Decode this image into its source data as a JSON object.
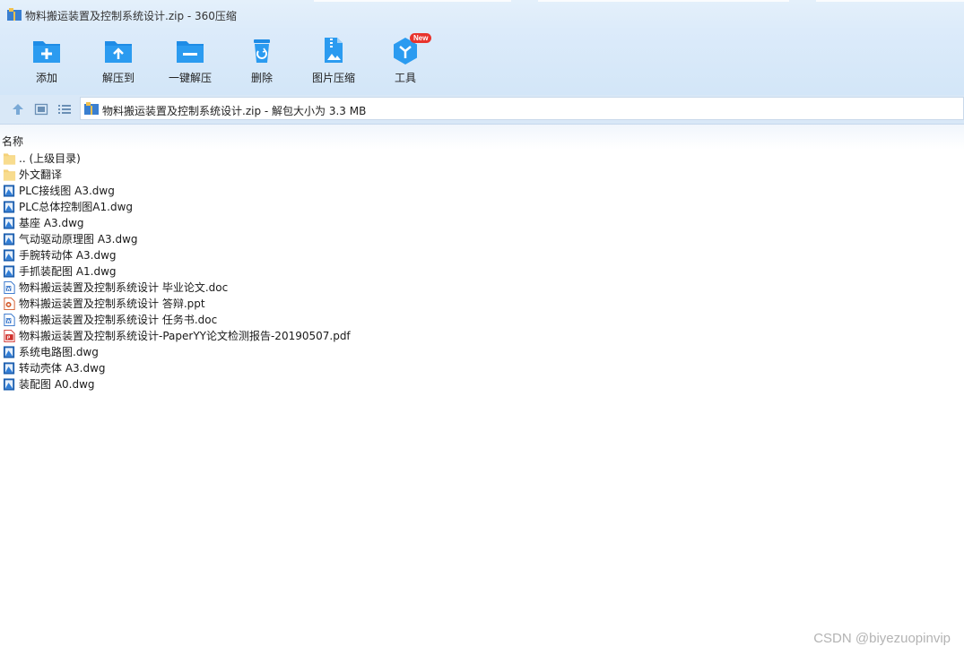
{
  "window": {
    "title": "物料搬运装置及控制系统设计.zip - 360压缩"
  },
  "toolbar": {
    "buttons": [
      {
        "label": "添加",
        "icon": "add-icon"
      },
      {
        "label": "解压到",
        "icon": "extract-to-icon"
      },
      {
        "label": "一键解压",
        "icon": "one-click-extract-icon"
      },
      {
        "label": "删除",
        "icon": "delete-icon"
      },
      {
        "label": "图片压缩",
        "icon": "image-compress-icon"
      },
      {
        "label": "工具",
        "icon": "tools-icon",
        "badge": "New"
      }
    ]
  },
  "address": {
    "path": "物料搬运装置及控制系统设计.zip - 解包大小为 3.3 MB"
  },
  "list": {
    "column_name": "名称",
    "files": [
      {
        "name": ".. (上级目录)",
        "type": "folder"
      },
      {
        "name": "外文翻译",
        "type": "folder"
      },
      {
        "name": "PLC接线图 A3.dwg",
        "type": "dwg"
      },
      {
        "name": "PLC总体控制图A1.dwg",
        "type": "dwg"
      },
      {
        "name": "基座 A3.dwg",
        "type": "dwg"
      },
      {
        "name": "气动驱动原理图 A3.dwg",
        "type": "dwg"
      },
      {
        "name": "手腕转动体 A3.dwg",
        "type": "dwg"
      },
      {
        "name": "手抓装配图 A1.dwg",
        "type": "dwg"
      },
      {
        "name": "物料搬运装置及控制系统设计 毕业论文.doc",
        "type": "doc"
      },
      {
        "name": "物料搬运装置及控制系统设计 答辩.ppt",
        "type": "ppt"
      },
      {
        "name": "物料搬运装置及控制系统设计 任务书.doc",
        "type": "doc"
      },
      {
        "name": "物料搬运装置及控制系统设计-PaperYY论文检测报告-20190507.pdf",
        "type": "pdf"
      },
      {
        "name": "系统电路图.dwg",
        "type": "dwg"
      },
      {
        "name": "转动壳体 A3.dwg",
        "type": "dwg"
      },
      {
        "name": "装配图 A0.dwg",
        "type": "dwg"
      }
    ]
  },
  "watermark": "CSDN @biyezuopinvip",
  "colors": {
    "accent": "#1e8ce6",
    "toolbar_bg": "#d8e8f9",
    "folder": "#f5d27a",
    "badge": "#e8342d"
  }
}
